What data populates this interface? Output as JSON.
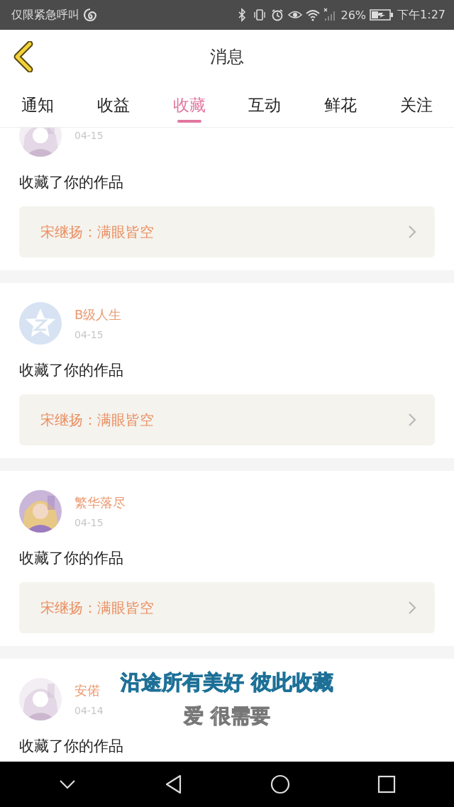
{
  "status_bar": {
    "carrier": "仅限紧急呼叫",
    "battery": "26%",
    "time": "下午1:27"
  },
  "header": {
    "title": "消息"
  },
  "tabs": [
    {
      "label": "通知",
      "selected": false
    },
    {
      "label": "收益",
      "selected": false
    },
    {
      "label": "收藏",
      "selected": true
    },
    {
      "label": "互动",
      "selected": false
    },
    {
      "label": "鲜花",
      "selected": false
    },
    {
      "label": "关注",
      "selected": false
    }
  ],
  "messages": [
    {
      "date": "04-15",
      "action": "收藏了你的作品",
      "work": "宋继扬：满眼皆空"
    },
    {
      "avatar": {
        "kind": "default"
      },
      "name": "B级人生",
      "date": "04-15",
      "action": "收藏了你的作品",
      "work": "宋继扬：满眼皆空"
    },
    {
      "name": "繁华落尽",
      "date": "04-15",
      "action": "收藏了你的作品",
      "work": "宋继扬：满眼皆空"
    },
    {
      "name": "安偌",
      "date": "04-14",
      "action": "收藏了你的作品"
    }
  ],
  "lyrics_overlay": {
    "lines": [
      "沿途所有美好 彼此收藏",
      "爱 很需要"
    ]
  }
}
